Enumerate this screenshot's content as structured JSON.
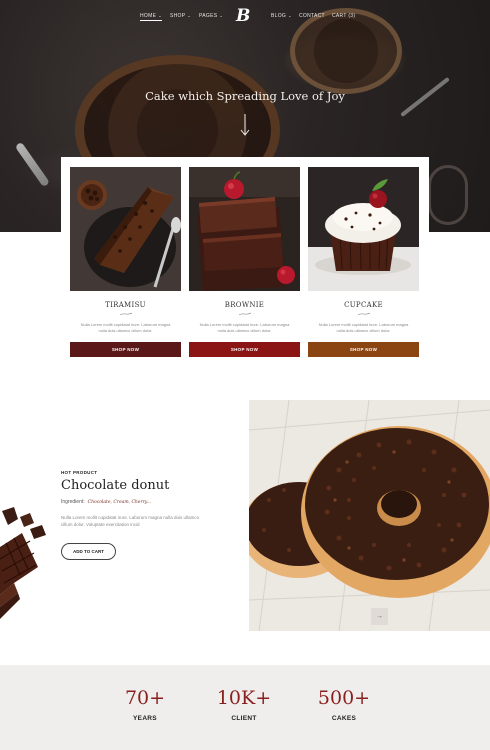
{
  "nav": {
    "items": [
      {
        "label": "HOME",
        "dropdown": true,
        "active": true
      },
      {
        "label": "SHOP",
        "dropdown": true,
        "active": false
      },
      {
        "label": "PAGES",
        "dropdown": true,
        "active": false
      },
      {
        "label": "BLOG",
        "dropdown": true,
        "active": false
      },
      {
        "label": "CONTACT",
        "dropdown": false,
        "active": false
      },
      {
        "label": "CART (3)",
        "dropdown": false,
        "active": false
      }
    ],
    "logo": "B"
  },
  "hero": {
    "title": "Cake which Spreading Love of Joy"
  },
  "products": [
    {
      "name": "TIRAMISU",
      "desc": "Nulla Lorem mollit cupidatat irure. Laborum magna nulla duis ullamco cillum dolor.",
      "button": "SHOP NOW",
      "button_color": "#5a1818"
    },
    {
      "name": "BROWNIE",
      "desc": "Nulla Lorem mollit cupidatat irure. Laborum magna nulla duis ullamco cillum dolor.",
      "button": "SHOP NOW",
      "button_color": "#8b1414"
    },
    {
      "name": "CUPCAKE",
      "desc": "Nulla Lorem mollit cupidatat irure. Laborum magna nulla duis ullamco cillum dolor.",
      "button": "SHOP NOW",
      "button_color": "#8a4512"
    }
  ],
  "hot_product": {
    "tag": "HOT PRODUCT",
    "title": "Chocolate donut",
    "ingredients_label": "Ingredient:",
    "ingredients_value": "Chocolate, Cream, Cherry...",
    "desc": "Nulla Lorem mollit cupidatat irure. Laborum magna nulla duis ullamco cillum dolor. Voluptate exercitation incid",
    "button": "ADD TO CART"
  },
  "stats": [
    {
      "num": "70+",
      "label": "YEARS"
    },
    {
      "num": "10K+",
      "label": "CLIENT"
    },
    {
      "num": "500+",
      "label": "CAKES"
    }
  ],
  "colors": {
    "accent": "#8a1f1f",
    "hero_bg": "#2a2524",
    "stats_bg": "#efeeec"
  }
}
